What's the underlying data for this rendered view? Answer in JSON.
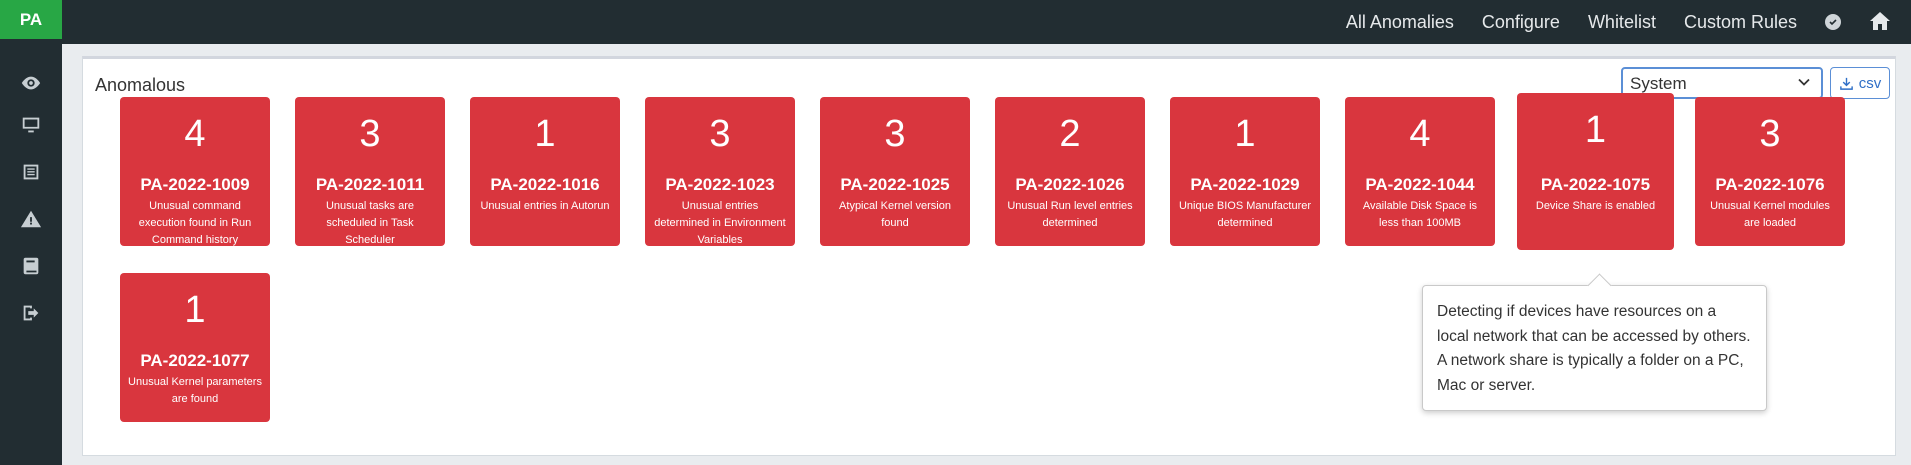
{
  "sidebar": {
    "brand": "PA",
    "items": [
      {
        "icon": "eye-icon"
      },
      {
        "icon": "monitor-icon"
      },
      {
        "icon": "list-icon"
      },
      {
        "icon": "warning-icon"
      },
      {
        "icon": "book-icon"
      },
      {
        "icon": "logout-icon"
      }
    ]
  },
  "topnav": {
    "items": [
      "All Anomalies",
      "Configure",
      "Whitelist",
      "Custom Rules"
    ],
    "status_icon": "check-circle-icon",
    "home_icon": "home-icon"
  },
  "panel": {
    "title": "Anomalous",
    "select_value": "System",
    "csv_label": "csv"
  },
  "tiles": [
    {
      "count": "4",
      "code": "PA-2022-1009",
      "desc": "Unusual command execution found in Run Command history"
    },
    {
      "count": "3",
      "code": "PA-2022-1011",
      "desc": "Unusual tasks are scheduled in Task Scheduler"
    },
    {
      "count": "1",
      "code": "PA-2022-1016",
      "desc": "Unusual entries in Autorun"
    },
    {
      "count": "3",
      "code": "PA-2022-1023",
      "desc": "Unusual entries determined in Environment Variables"
    },
    {
      "count": "3",
      "code": "PA-2022-1025",
      "desc": "Atypical Kernel version found"
    },
    {
      "count": "2",
      "code": "PA-2022-1026",
      "desc": "Unusual Run level entries determined"
    },
    {
      "count": "1",
      "code": "PA-2022-1029",
      "desc": "Unique BIOS Manufacturer determined"
    },
    {
      "count": "4",
      "code": "PA-2022-1044",
      "desc": "Available Disk Space is less than 100MB"
    },
    {
      "count": "1",
      "code": "PA-2022-1075",
      "desc": "Device Share is enabled"
    },
    {
      "count": "3",
      "code": "PA-2022-1076",
      "desc": "Unusual Kernel modules are loaded"
    },
    {
      "count": "1",
      "code": "PA-2022-1077",
      "desc": "Unusual Kernel parameters are found"
    }
  ],
  "tooltip": {
    "text": "Detecting if devices have resources on a local network that can be accessed by others. A network share is typically a folder on a PC, Mac or server."
  },
  "colors": {
    "tile": "#d9363e",
    "sidebar": "#222d32",
    "brand": "#28a745",
    "accent": "#5b8fd6"
  }
}
